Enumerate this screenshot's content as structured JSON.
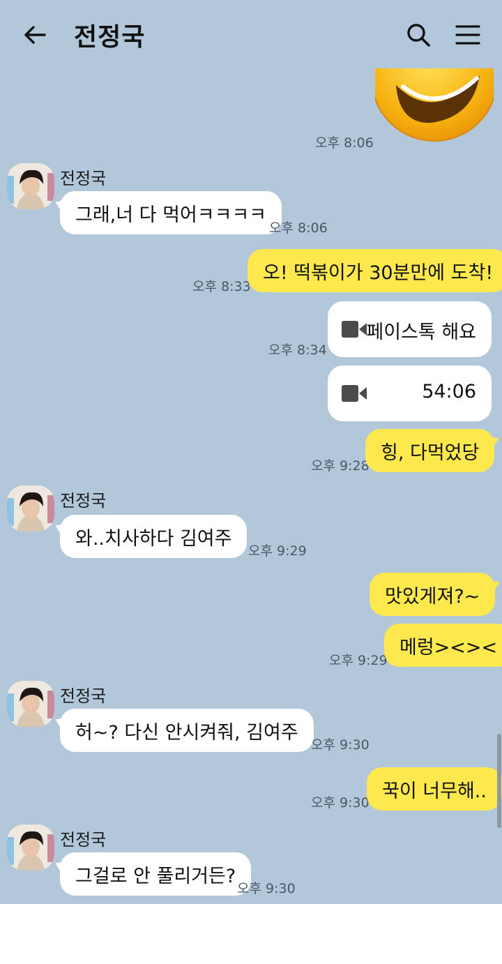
{
  "header": {
    "title": "전정국"
  },
  "contact": {
    "name": "전정국"
  },
  "messages": [
    {
      "type": "emoticon",
      "direction": "out",
      "icon": "winking-smiley-emoticon",
      "time": "오후 8:06"
    },
    {
      "type": "text",
      "direction": "in",
      "sender": "전정국",
      "text": "그래,너 다 먹어ㅋㅋㅋㅋ",
      "time": "오후 8:06"
    },
    {
      "type": "text",
      "direction": "out",
      "text": "오! 떡볶이가 30분만에 도착!",
      "time": "오후 8:33"
    },
    {
      "type": "call",
      "direction": "out",
      "icon": "video-camera-icon",
      "text": "페이스톡 해요",
      "time": "오후 8:34"
    },
    {
      "type": "call",
      "direction": "out",
      "icon": "video-camera-icon",
      "text": "54:06"
    },
    {
      "type": "text",
      "direction": "out",
      "text": "힝, 다먹었당",
      "time": "오후 9:28"
    },
    {
      "type": "text",
      "direction": "in",
      "sender": "전정국",
      "text": "와..치사하다 김여주",
      "time": "오후 9:29"
    },
    {
      "type": "text",
      "direction": "out",
      "text": "맛있게져?~"
    },
    {
      "type": "text",
      "direction": "out",
      "text": "메렁><><",
      "time": "오후 9:29"
    },
    {
      "type": "text",
      "direction": "in",
      "sender": "전정국",
      "text": "허~? 다신 안시켜줘, 김여주",
      "time": "오후 9:30"
    },
    {
      "type": "text",
      "direction": "out",
      "text": "꾹이 너무해..",
      "time": "오후 9:30"
    },
    {
      "type": "text",
      "direction": "in",
      "sender": "전정국",
      "text": "그걸로 안 풀리거든?",
      "time": "오후 9:30"
    }
  ],
  "input": {
    "value": "",
    "placeholder": ""
  },
  "icons": {
    "back": "arrow-left-icon",
    "search": "search-icon",
    "menu": "hamburger-menu-icon",
    "attach": "plus-square-icon",
    "emoji": "smiley-face-icon",
    "hash": "#"
  },
  "colors": {
    "background": "#b2c7da",
    "outgoing_bubble": "#fde84e",
    "incoming_bubble": "#ffffff",
    "cursor": "#128c74"
  }
}
